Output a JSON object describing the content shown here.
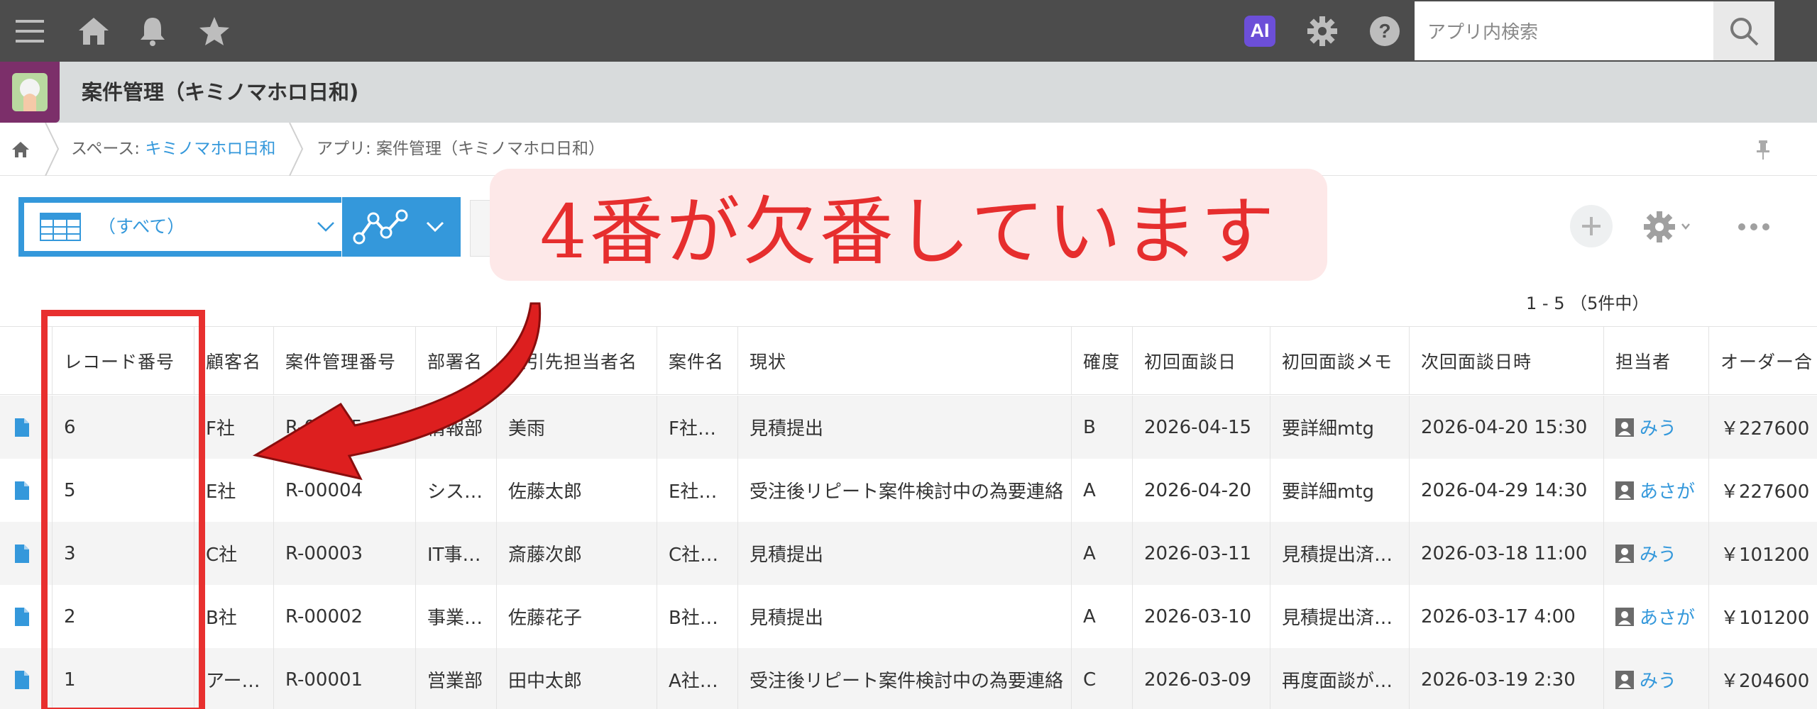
{
  "topbar": {
    "menu_icon": "hamburger-icon",
    "home_icon": "home-icon",
    "bell_icon": "bell-icon",
    "star_icon": "star-icon",
    "ai_badge": "AI",
    "settings_icon": "gear-icon",
    "help_icon": "help-icon",
    "search_placeholder": "アプリ内検索",
    "search_icon": "search-icon"
  },
  "app": {
    "title": "案件管理（キミノマホロ日和)"
  },
  "breadcrumb": {
    "space_prefix": "スペース: ",
    "space_name": "キミノマホロ日和",
    "app_label": "アプリ: 案件管理（キミノマホロ日和）"
  },
  "toolbar": {
    "view_name": "（すべて）",
    "record_count": "1 - 5 （5件中）"
  },
  "annotation": {
    "callout_text": "4番が欠番しています",
    "color": "#e62e2e"
  },
  "table": {
    "headers": [
      "レコード番号",
      "顧客名",
      "案件管理番号",
      "部署名",
      "取引先担当者名",
      "案件名",
      "現状",
      "確度",
      "初回面談日",
      "初回面談メモ",
      "次回面談日時",
      "担当者",
      "オーダー合"
    ],
    "rows": [
      {
        "no": "6",
        "customer": "F社",
        "case_no": "R-00005",
        "dept": "情報部",
        "contact": "美雨",
        "case_name": "F社…",
        "status": "見積提出",
        "rank": "B",
        "first_date": "2026-04-15",
        "memo": "要詳細mtg",
        "next": "2026-04-20 15:30",
        "owner": "みう",
        "order": "￥227600"
      },
      {
        "no": "5",
        "customer": "E社",
        "case_no": "R-00004",
        "dept": "シス…",
        "contact": "佐藤太郎",
        "case_name": "E社…",
        "status": "受注後リピート案件検討中の為要連絡",
        "rank": "A",
        "first_date": "2026-04-20",
        "memo": "要詳細mtg",
        "next": "2026-04-29 14:30",
        "owner": "あさが",
        "order": "￥227600"
      },
      {
        "no": "3",
        "customer": "C社",
        "case_no": "R-00003",
        "dept": "IT事…",
        "contact": "斎藤次郎",
        "case_name": "C社…",
        "status": "見積提出",
        "rank": "A",
        "first_date": "2026-03-11",
        "memo": "見積提出済…",
        "next": "2026-03-18 11:00",
        "owner": "みう",
        "order": "￥101200"
      },
      {
        "no": "2",
        "customer": "B社",
        "case_no": "R-00002",
        "dept": "事業…",
        "contact": "佐藤花子",
        "case_name": "B社…",
        "status": "見積提出",
        "rank": "A",
        "first_date": "2026-03-10",
        "memo": "見積提出済…",
        "next": "2026-03-17 4:00",
        "owner": "あさが",
        "order": "￥101200"
      },
      {
        "no": "1",
        "customer": "アー…",
        "case_no": "R-00001",
        "dept": "営業部",
        "contact": "田中太郎",
        "case_name": "A社…",
        "status": "受注後リピート案件検討中の為要連絡",
        "rank": "C",
        "first_date": "2026-03-09",
        "memo": "再度面談が…",
        "next": "2026-03-19 2:30",
        "owner": "みう",
        "order": "￥204600"
      }
    ]
  }
}
